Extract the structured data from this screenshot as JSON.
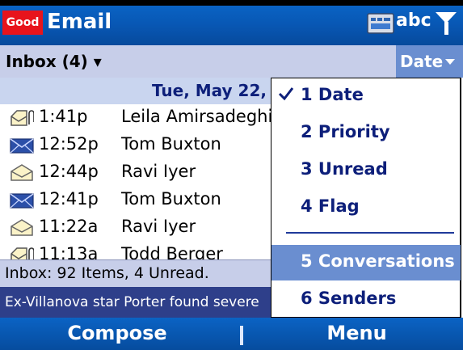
{
  "title_bar": {
    "logo_text": "Good",
    "app_title": "Email",
    "input_mode": "abc",
    "icons": [
      "keyboard-sip-icon",
      "signal-strength-icon"
    ]
  },
  "folder_bar": {
    "folder_label": "Inbox (4) ▾",
    "sort_label": "Date"
  },
  "list": {
    "date_header": "Tue, May 22,",
    "messages": [
      {
        "time": "1:41p",
        "sender": "Leila Amirsadeghi",
        "icon": "read-attachment-icon"
      },
      {
        "time": "12:52p",
        "sender": "Tom Buxton",
        "icon": "unread-envelope-icon"
      },
      {
        "time": "12:44p",
        "sender": "Ravi Iyer",
        "icon": "read-envelope-icon"
      },
      {
        "time": "12:41p",
        "sender": "Tom Buxton",
        "icon": "unread-envelope-icon"
      },
      {
        "time": "11:22a",
        "sender": "Ravi Iyer",
        "icon": "read-envelope-icon"
      },
      {
        "time": "11:13a",
        "sender": "Todd Berger",
        "icon": "read-attachment-icon"
      }
    ]
  },
  "status": {
    "text": "Inbox: 92 Items, 4 Unread.",
    "news": "Ex-Villanova star Porter found severe"
  },
  "sort_menu": {
    "items": [
      {
        "label": "1 Date",
        "checked": true
      },
      {
        "label": "2 Priority"
      },
      {
        "label": "3 Unread"
      },
      {
        "label": "4 Flag"
      },
      {
        "label": "5 Conversations",
        "selected": true
      },
      {
        "label": "6 Senders"
      }
    ]
  },
  "softkeys": {
    "left": "Compose",
    "right": "Menu"
  },
  "colors": {
    "title_bar": "#0857b4",
    "folder_bar": "#c7cee9",
    "menu_highlight": "#6a8ed0",
    "logo": "#e8141c",
    "news_bar": "#2e3f8a"
  }
}
